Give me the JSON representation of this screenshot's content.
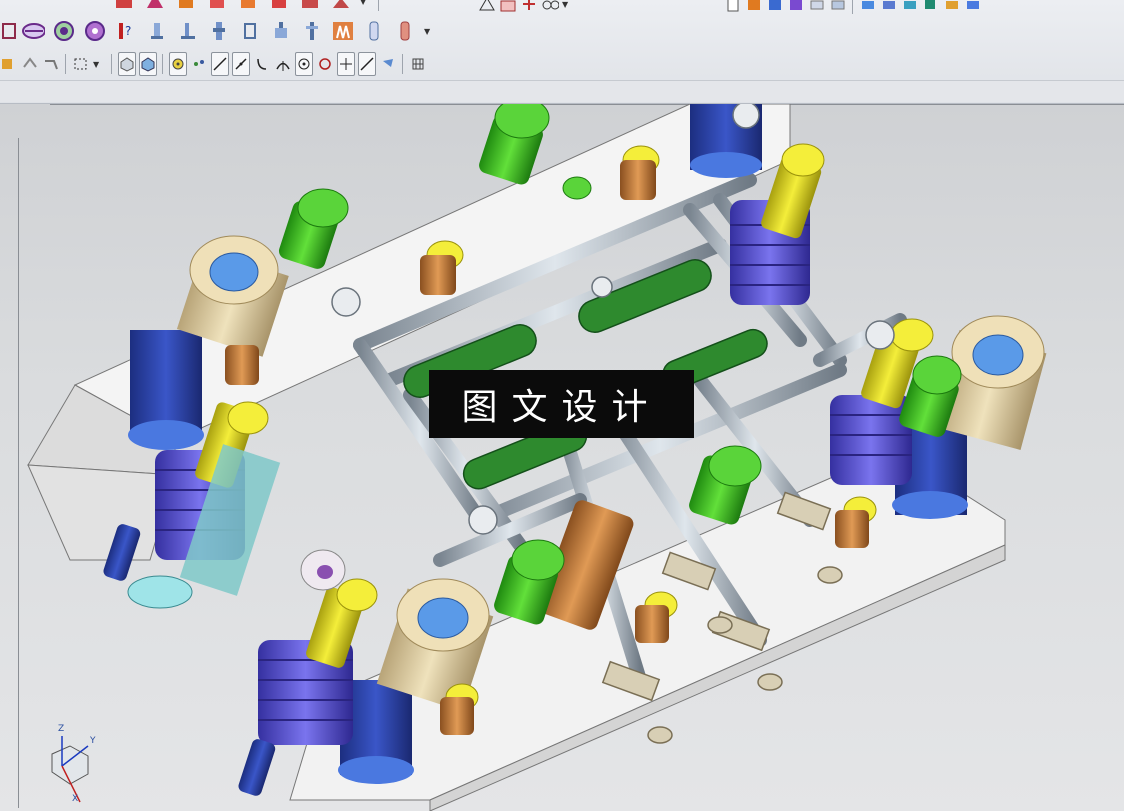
{
  "toolbar": {
    "row1_icons": [
      "part-icon",
      "cut-icon",
      "extrude-icon",
      "revolve-icon",
      "shell-icon",
      "draft-icon",
      "pattern-icon",
      "rib-icon",
      "fillet-icon",
      "chamfer-icon"
    ],
    "row2_icons": [
      "coil-icon",
      "dimension-icon",
      "gear-icon",
      "spring-icon",
      "bolt-icon",
      "nut-icon",
      "washer-icon",
      "pin-icon",
      "stand-icon",
      "bush-icon",
      "dowel-icon",
      "mold-insert-icon",
      "sleeve-icon",
      "cylinder-icon"
    ],
    "row3_icons": [
      "view-cube-icon",
      "shaded-icon",
      "snap-icon",
      "point-icon",
      "line-icon",
      "slash-icon",
      "curve-icon",
      "intersect-icon",
      "circle-center-icon",
      "circle-icon",
      "cross-icon",
      "tangent-line-icon",
      "material-icon",
      "grid-icon"
    ],
    "right_icons": [
      "page-icon",
      "box-orange-icon",
      "box-blue-icon",
      "box-purple-icon",
      "stack-icon",
      "sheet-icon",
      "layer-icon",
      "cube-blue-icon",
      "export-icon",
      "flag-icon",
      "arrow-icon",
      "import-icon"
    ]
  },
  "viewport": {
    "watermark_text": "图文设计",
    "triad": {
      "x_label": "X",
      "y_label": "Y",
      "z_label": "Z"
    },
    "colors": {
      "plate": "#ffffff",
      "guide_post_blue": "#2a3e9e",
      "bushing_tan": "#d9c79a",
      "spring_purple": "#5650cc",
      "bolt_green": "#3fbf1f",
      "pin_yellow": "#e6e01a",
      "pin_orange": "#c9833a",
      "tube_steel": "#a9b3bd",
      "link_green": "#2e7d2e"
    }
  }
}
